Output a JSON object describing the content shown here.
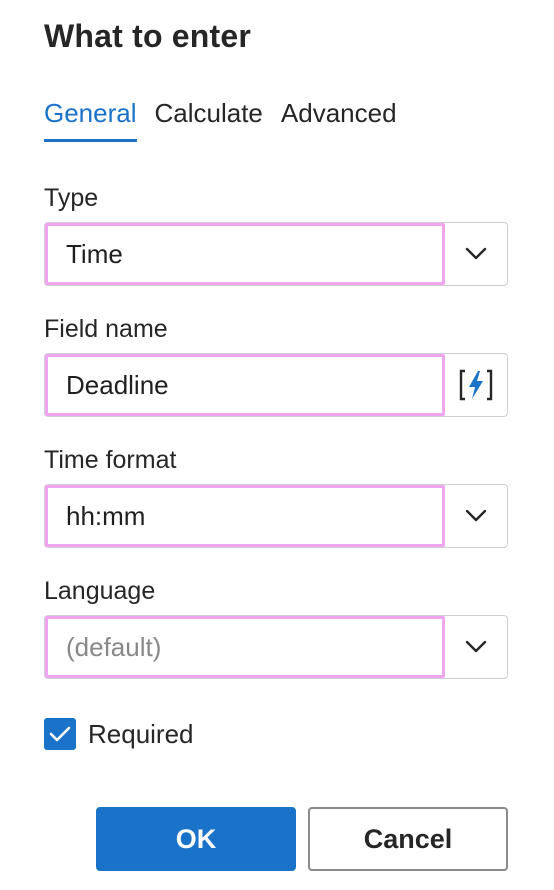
{
  "dialog": {
    "title": "What to enter"
  },
  "tabs": [
    {
      "label": "General",
      "active": true
    },
    {
      "label": "Calculate",
      "active": false
    },
    {
      "label": "Advanced",
      "active": false
    }
  ],
  "fields": {
    "type": {
      "label": "Type",
      "value": "Time",
      "control": "dropdown"
    },
    "field_name": {
      "label": "Field name",
      "value": "Deadline",
      "control": "lightning-button"
    },
    "time_format": {
      "label": "Time format",
      "value": "hh:mm",
      "control": "dropdown"
    },
    "language": {
      "label": "Language",
      "placeholder": "(default)",
      "control": "dropdown"
    }
  },
  "required": {
    "label": "Required",
    "checked": true
  },
  "buttons": {
    "ok": "OK",
    "cancel": "Cancel"
  },
  "colors": {
    "accent": "#1a73c8",
    "highlight_border": "#f0a6ee"
  },
  "icons": {
    "dropdown": "chevron-down-icon",
    "field_action": "lightning-bolt-icon",
    "checkbox": "checkmark-icon"
  }
}
